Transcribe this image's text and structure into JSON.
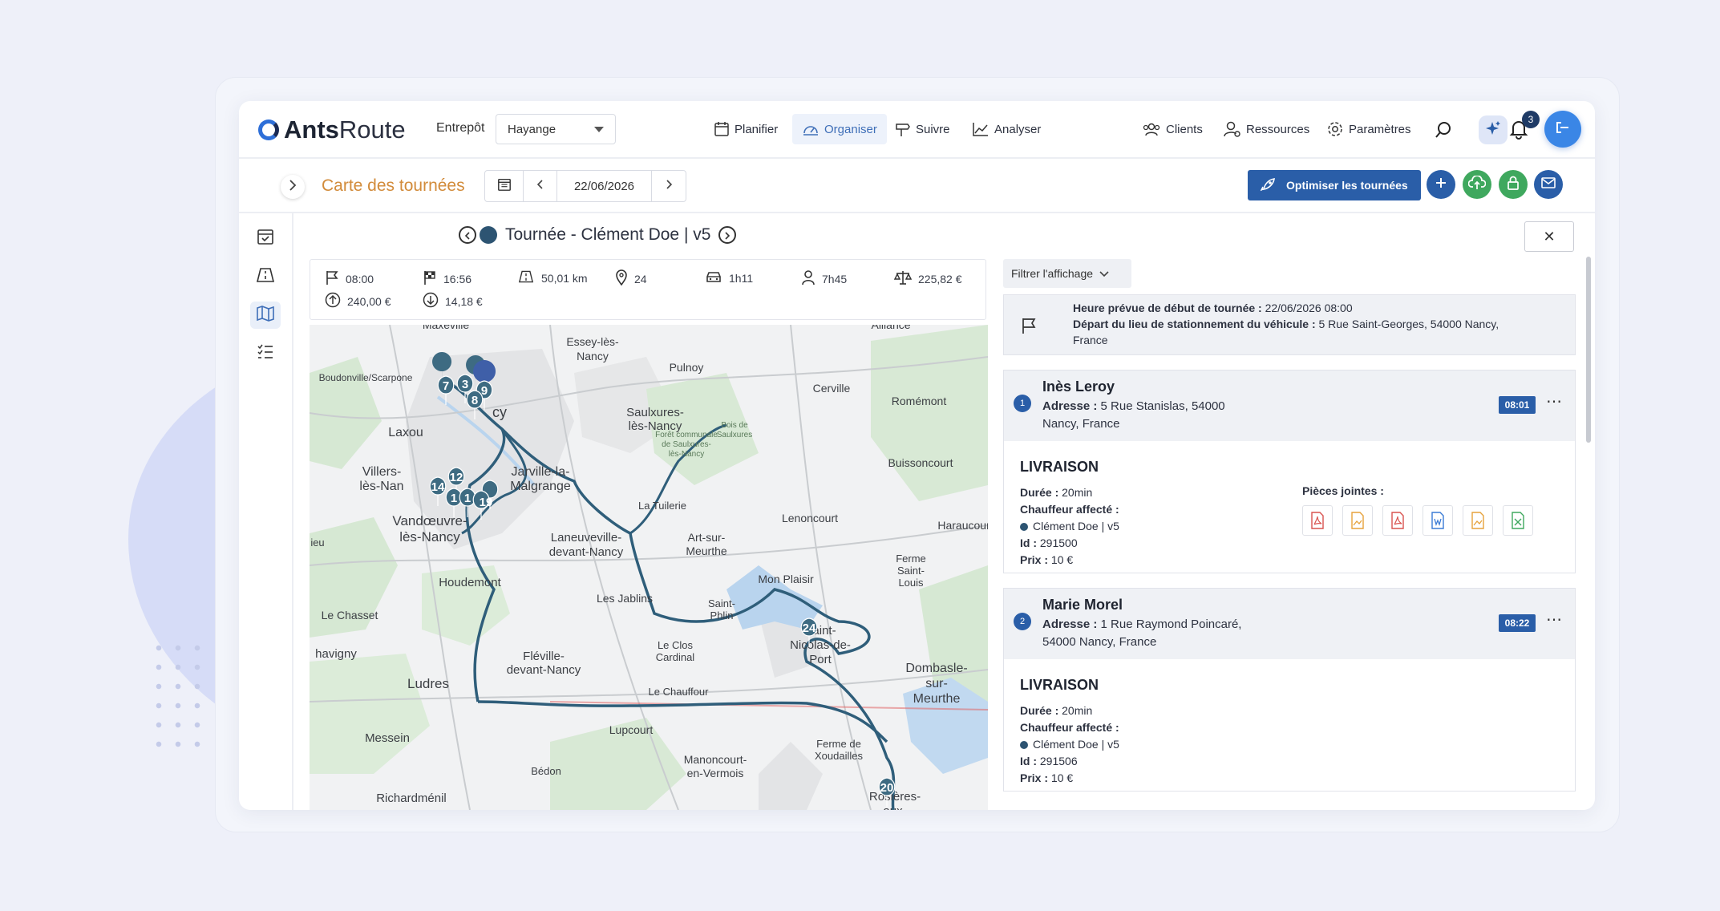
{
  "topbar": {
    "logo_bold": "Ants",
    "logo_rest": "Route",
    "warehouse_label": "Entrepôt",
    "warehouse_value": "Hayange",
    "nav": [
      {
        "label": "Planifier",
        "icon": "calendar-icon"
      },
      {
        "label": "Organiser",
        "icon": "gauge-icon",
        "active": true
      },
      {
        "label": "Suivre",
        "icon": "signpost-icon"
      },
      {
        "label": "Analyser",
        "icon": "chart-icon"
      }
    ],
    "right_nav": [
      {
        "label": "Clients",
        "icon": "people-icon"
      },
      {
        "label": "Ressources",
        "icon": "user-gear-icon"
      },
      {
        "label": "Paramètres",
        "icon": "gear-icon"
      }
    ],
    "notifications_count": "3",
    "accent": "#2a5ea8"
  },
  "subbar": {
    "page_title": "Carte des tournées",
    "date": "22/06/2026",
    "optimize_label": "Optimiser les tournées"
  },
  "route": {
    "title": "Tournée - Clément Doe | v5",
    "stats": {
      "start_time": "08:00",
      "end_time": "16:56",
      "distance": "50,01 km",
      "stops": "24",
      "drive_time": "1h11",
      "work_time": "7h45",
      "total_cost": "225,82 €",
      "revenue_up": "240,00 €",
      "revenue_down": "14,18 €"
    }
  },
  "map": {
    "labels": [
      "Essey-lès-Nancy",
      "Pulnoy",
      "Cerville",
      "Romémont",
      "Boudonville/Scarpone",
      "Laxou",
      "Saulxures-lès-Nancy",
      "Villers-lès-Nancy",
      "Jarville-la-Malgrange",
      "Buissoncourt",
      "Vandœuvre-lès-Nancy",
      "Laneuveville-devant-Nancy",
      "Art-sur-Meurthe",
      "Lenoncourt",
      "Haraucourt",
      "Houdemont",
      "Mon Plaisir",
      "Ferme Saint-Louis",
      "Les Jablins",
      "Saint-Phlin",
      "Le Chasset",
      "Saint-Nicolas-de-Port",
      "Fléville-devant-Nancy",
      "Le Clos Cardinal",
      "Ludres",
      "Dombasle-sur-Meurthe",
      "Le Chauffour",
      "Lupcourt",
      "Messein",
      "Ferme de Xoudailles",
      "Manoncourt-en-Vermois",
      "Bédon",
      "Richardménil",
      "Rosières-aux-Salines",
      "La Tuilerie",
      "Alliance",
      "Maxéville",
      "Forêt communale de Saulxures-lès-Nancy",
      "Bois de Saulxures",
      "havigny",
      "ieu",
      "cy"
    ],
    "markers": [
      "7",
      "3",
      "9",
      "8",
      "12",
      "14",
      "1",
      "1",
      "19",
      "24",
      "20"
    ]
  },
  "panel": {
    "filter_label": "Filtrer l'affichage",
    "start": {
      "line1_label": "Heure prévue de début de tournée :",
      "line1_value": "22/06/2026 08:00",
      "line2_label": "Départ du lieu de stationnement du véhicule :",
      "line2_value": "5 Rue Saint-Georges, 54000 Nancy,",
      "line2_cont": "France"
    },
    "stops": [
      {
        "num": "1",
        "name": "Inès Leroy",
        "address_label": "Adresse :",
        "address_l1": "5 Rue Stanislas, 54000",
        "address_l2": "Nancy, France",
        "time": "08:01",
        "type": "LIVRAISON",
        "duration_label": "Durée :",
        "duration": "20min",
        "driver_label": "Chauffeur affecté :",
        "driver": "Clément Doe | v5",
        "id_label": "Id :",
        "id": "291500",
        "price_label": "Prix :",
        "price": "10 €",
        "attachments_label": "Pièces jointes :"
      },
      {
        "num": "2",
        "name": "Marie Morel",
        "address_label": "Adresse :",
        "address_l1": "1 Rue Raymond Poincaré,",
        "address_l2": "54000 Nancy, France",
        "time": "08:22",
        "type": "LIVRAISON",
        "duration_label": "Durée :",
        "duration": "20min",
        "driver_label": "Chauffeur affecté :",
        "driver": "Clément Doe | v5",
        "id_label": "Id :",
        "id": "291506",
        "price_label": "Prix :",
        "price": "10 €"
      }
    ]
  }
}
